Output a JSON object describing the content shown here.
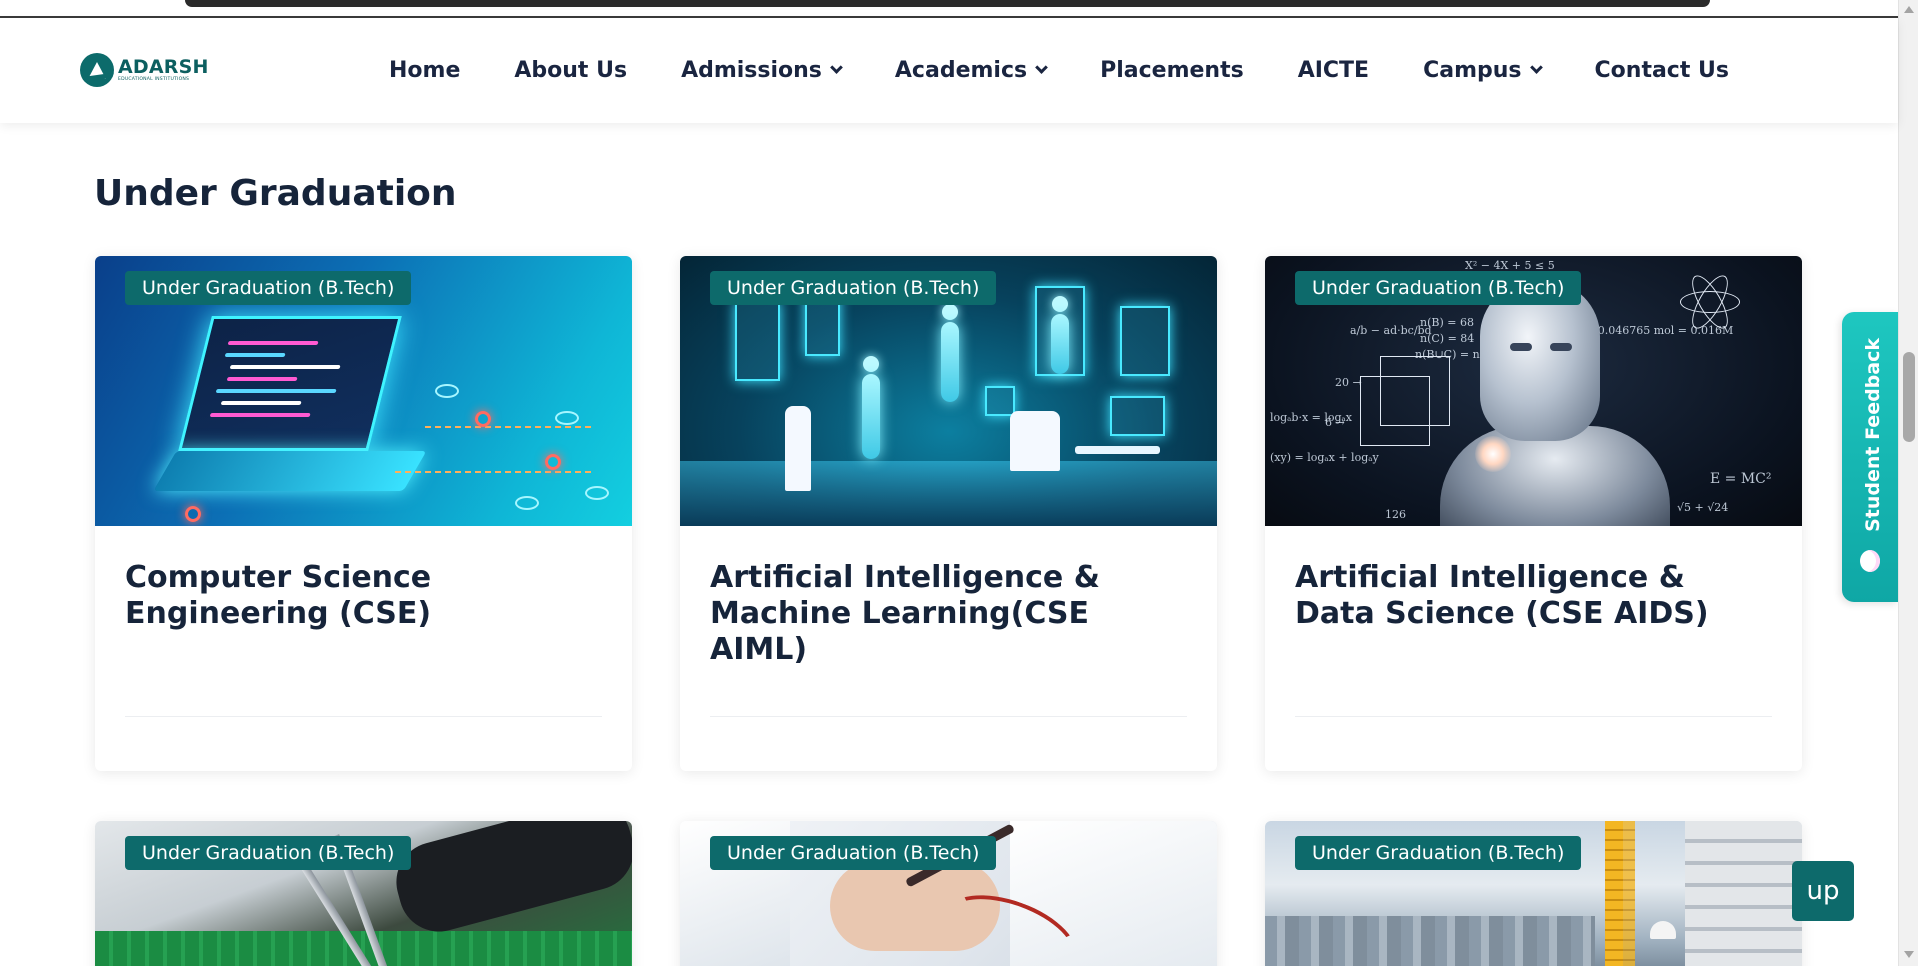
{
  "brand": {
    "name": "ADARSH",
    "tagline": "EDUCATIONAL INSTITUTIONS",
    "color": "#0c6b6b"
  },
  "nav": {
    "items": [
      {
        "label": "Home",
        "dropdown": false
      },
      {
        "label": "About Us",
        "dropdown": false
      },
      {
        "label": "Admissions",
        "dropdown": true
      },
      {
        "label": "Academics",
        "dropdown": true
      },
      {
        "label": "Placements",
        "dropdown": false
      },
      {
        "label": "AICTE",
        "dropdown": false
      },
      {
        "label": "Campus",
        "dropdown": true
      },
      {
        "label": "Contact Us",
        "dropdown": false
      }
    ]
  },
  "section": {
    "title": "Under Graduation"
  },
  "cards": [
    {
      "badge": "Under Graduation (B.Tech)",
      "title": "Computer Science Engineering (CSE)",
      "image": "laptop-circuit-image"
    },
    {
      "badge": "Under Graduation (B.Tech)",
      "title": "Artificial Intelligence & Machine Learning(CSE AIML)",
      "image": "ai-hologram-image"
    },
    {
      "badge": "Under Graduation (B.Tech)",
      "title": "Artificial Intelligence & Data Science (CSE AIDS)",
      "image": "robot-formulas-image"
    },
    {
      "badge": "Under Graduation (B.Tech)",
      "title": "",
      "image": "circuit-board-tweezers-image"
    },
    {
      "badge": "Under Graduation (B.Tech)",
      "title": "",
      "image": "multimeter-probe-image"
    },
    {
      "badge": "Under Graduation (B.Tech)",
      "title": "",
      "image": "construction-crane-image"
    }
  ],
  "feedback": {
    "label": "Student Feedback",
    "color": "#17b8b4"
  },
  "up_button": {
    "label": "up",
    "color": "#0d6a6b"
  },
  "formulas": {
    "f1": "X² − 4X + 5 ≤ 5",
    "f2": "n(B) = 68",
    "f3": "n(C) = 84",
    "f4": "n(B∪C) = n(B)",
    "f5": "a/b − ad·bc/bd",
    "f6": "logₐb·x = logₐx",
    "f7": "(xy) = logₐx + logₐy",
    "f8": "E = MC²",
    "f9": "√5 + √24",
    "f10": "20 →",
    "f11": "6 →",
    "f12": "126",
    "f13": "= 0.046765 mol = 0.016M"
  }
}
